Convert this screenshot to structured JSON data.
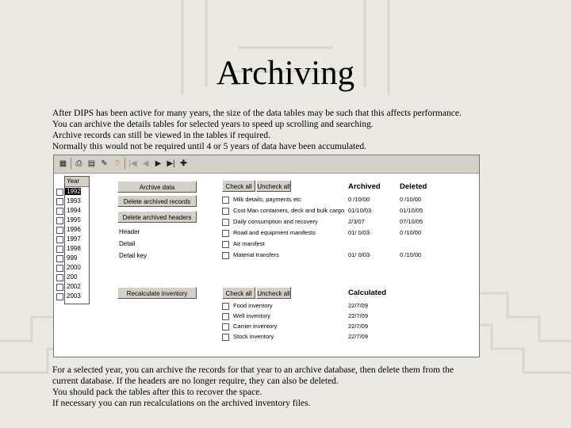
{
  "slide": {
    "title": "Archiving",
    "intro": [
      "After DIPS has been active for many years, the size of the data tables may be such that this affects performance.",
      "You can archive the details tables for selected years to speed up scrolling and searching.",
      "Archive records can still be viewed in the tables if required.",
      "Normally this would not be required until 4 or 5 years of data have been accumulated."
    ],
    "outro": [
      "For a selected year, you can archive the records for that year to an archive database, then delete them from the",
      "current database. If the headers are no longer require, they can also be deleted.",
      "You should pack the tables after this to recover the space.",
      "If necessary you can run recalculations on the archived inventory files."
    ]
  },
  "app": {
    "toolbar_icons": [
      "table-icon",
      "print-icon",
      "preview-icon",
      "export-icon",
      "help-icon",
      "first-icon",
      "prev-icon",
      "next-icon",
      "last-icon",
      "add-icon"
    ],
    "year_list": {
      "header": "Year",
      "years": [
        "1992",
        "1993",
        "1994",
        "1995",
        "1996",
        "1997",
        "1998",
        "999",
        "2000",
        "200",
        "2002",
        "2003"
      ],
      "selected_index": 0
    },
    "left_buttons": {
      "archive": "Archive data",
      "delete_records": "Delete archived records",
      "delete_headers": "Delete archived headers",
      "recalculate": "Recalculate inventory"
    },
    "left_labels": {
      "header": "Header",
      "detail": "Detail",
      "detail_key": "Detail key"
    },
    "archive_section": {
      "check_all": "Check all",
      "uncheck_all": "Uncheck all",
      "col_archived": "Archived",
      "col_deleted": "Deleted",
      "items": [
        {
          "label": "Milk details, payments etc",
          "archived": "0 /10/00",
          "deleted": "0 /10/00"
        },
        {
          "label": "Cost Man containers, deck and bulk cargo",
          "archived": "01/10/03",
          "deleted": "01/10/05"
        },
        {
          "label": "Daily consumption and recovery",
          "archived": "2/3/07",
          "deleted": "07/10/05"
        },
        {
          "label": "Road and equipment manifests",
          "archived": "01/ 0/03",
          "deleted": "0 /10/00"
        },
        {
          "label": "Air manifest",
          "archived": "",
          "deleted": ""
        },
        {
          "label": "Material transfers",
          "archived": "01/ 0/03",
          "deleted": "0 /10/00"
        }
      ]
    },
    "calc_section": {
      "check_all": "Check all",
      "uncheck_all": "Uncheck all",
      "col_calculated": "Calculated",
      "items": [
        {
          "label": "Food inventory",
          "calculated": "22/7/09"
        },
        {
          "label": "Well inventory",
          "calculated": "22/7/09"
        },
        {
          "label": "Carrier inventory",
          "calculated": "22/7/09"
        },
        {
          "label": "Stock inventory",
          "calculated": "22/7/09"
        }
      ]
    }
  }
}
